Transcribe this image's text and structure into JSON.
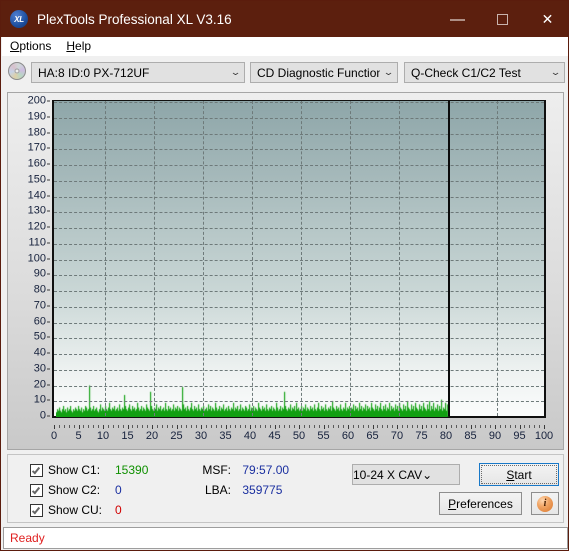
{
  "window": {
    "title": "PlexTools Professional XL V3.16",
    "icon": "xl-logo-icon",
    "minimize": "–",
    "maximize": "maximize-icon",
    "close": "✕"
  },
  "menubar": {
    "items": [
      {
        "label": "Options",
        "accel": "O"
      },
      {
        "label": "Help",
        "accel": "H"
      }
    ]
  },
  "toolbar": {
    "drive_icon": "cd-disc-icon",
    "drive": "HA:8 ID:0  PX-712UF",
    "function": "CD Diagnostic Functions",
    "test": "Q-Check C1/C2 Test",
    "chevron": "⌄"
  },
  "legend": {
    "rows": [
      {
        "label": "Show C1:",
        "value": "15390",
        "color": "#0f9000",
        "checked": true
      },
      {
        "label": "Show C2:",
        "value": "0",
        "color": "#1a2fa0",
        "checked": true
      },
      {
        "label": "Show CU:",
        "value": "0",
        "color": "#d00000",
        "checked": true
      }
    ]
  },
  "readouts": [
    {
      "key": "MSF:",
      "value": "79:57.00"
    },
    {
      "key": "LBA:",
      "value": "359775"
    }
  ],
  "controls": {
    "speed": "10-24 X CAV",
    "speed_chevron": "⌄",
    "start": "Start",
    "start_accel": "S",
    "preferences": "Preferences",
    "preferences_accel": "P",
    "info_icon": "info-circle-icon",
    "info_glyph": "i"
  },
  "statusbar": {
    "text": "Ready"
  },
  "chart_data": {
    "type": "bar",
    "title": "",
    "xlabel": "",
    "ylabel": "",
    "xlim": [
      0,
      100
    ],
    "ylim": [
      0,
      200
    ],
    "xticks": [
      0,
      5,
      10,
      15,
      20,
      25,
      30,
      35,
      40,
      45,
      50,
      55,
      60,
      65,
      70,
      75,
      80,
      85,
      90,
      95,
      100
    ],
    "yticks": [
      0,
      10,
      20,
      30,
      40,
      50,
      60,
      70,
      80,
      90,
      100,
      110,
      120,
      130,
      140,
      150,
      160,
      170,
      180,
      190,
      200
    ],
    "grid": true,
    "legend_position": "below-plot",
    "data_end_x": 80,
    "end_marker_x": 80,
    "series": [
      {
        "name": "C1",
        "color": "#12a012",
        "x_start": 0,
        "x_end": 80,
        "n_points": 396,
        "baseline": 4,
        "typical_max": 12,
        "spike_max": 21,
        "values": [
          3,
          5,
          4,
          6,
          4,
          3,
          5,
          7,
          4,
          5,
          3,
          6,
          4,
          5,
          7,
          4,
          3,
          5,
          4,
          6,
          5,
          4,
          7,
          5,
          4,
          6,
          3,
          5,
          4,
          7,
          6,
          4,
          5,
          20,
          6,
          4,
          5,
          7,
          4,
          5,
          6,
          4,
          3,
          5,
          8,
          4,
          6,
          5,
          4,
          7,
          5,
          4,
          6,
          9,
          5,
          4,
          6,
          5,
          7,
          4,
          5,
          6,
          4,
          8,
          5,
          4,
          6,
          5,
          14,
          7,
          5,
          4,
          6,
          8,
          5,
          4,
          7,
          5,
          6,
          4,
          5,
          9,
          6,
          4,
          5,
          7,
          4,
          6,
          5,
          4,
          8,
          6,
          5,
          4,
          16,
          7,
          5,
          4,
          6,
          5,
          8,
          4,
          6,
          5,
          7,
          4,
          5,
          6,
          4,
          9,
          5,
          4,
          7,
          5,
          6,
          4,
          5,
          8,
          4,
          6,
          5,
          7,
          4,
          6,
          5,
          4,
          19,
          8,
          5,
          6,
          4,
          7,
          5,
          4,
          6,
          9,
          5,
          4,
          7,
          5,
          6,
          4,
          8,
          5,
          4,
          6,
          5,
          7,
          4,
          5,
          6,
          4,
          8,
          5,
          7,
          4,
          6,
          5,
          4,
          9,
          6,
          4,
          5,
          7,
          4,
          6,
          5,
          8,
          4,
          5,
          6,
          4,
          7,
          5,
          4,
          6,
          5,
          9,
          4,
          6,
          5,
          7,
          4,
          5,
          8,
          4,
          6,
          5,
          4,
          7,
          6,
          4,
          5,
          8,
          4,
          6,
          5,
          7,
          4,
          6,
          5,
          4,
          9,
          6,
          5,
          4,
          7,
          5,
          6,
          4,
          8,
          5,
          4,
          6,
          5,
          7,
          4,
          6,
          5,
          4,
          9,
          6,
          4,
          5,
          7,
          4,
          6,
          5,
          16,
          7,
          5,
          4,
          6,
          5,
          8,
          4,
          6,
          5,
          7,
          4,
          9,
          5,
          6,
          4,
          5,
          7,
          4,
          6,
          5,
          8,
          4,
          6,
          5,
          4,
          7,
          5,
          6,
          4,
          8,
          5,
          4,
          6,
          9,
          5,
          4,
          7,
          5,
          6,
          4,
          8,
          5,
          4,
          6,
          5,
          7,
          4,
          10,
          6,
          5,
          4,
          7,
          5,
          6,
          4,
          8,
          5,
          4,
          6,
          5,
          9,
          4,
          6,
          5,
          7,
          4,
          6,
          5,
          8,
          4,
          7,
          5,
          6,
          4,
          9,
          5,
          7,
          4,
          6,
          5,
          8,
          4,
          7,
          5,
          6,
          4,
          9,
          6,
          5,
          4,
          8,
          5,
          7,
          4,
          6,
          9,
          5,
          4,
          7,
          5,
          8,
          4,
          6,
          5,
          9,
          4,
          7,
          5,
          6,
          4,
          8,
          5,
          7,
          4,
          9,
          6,
          5,
          4,
          8,
          5,
          7,
          4,
          10,
          6,
          5,
          4,
          8,
          5,
          7,
          4,
          9,
          6,
          5,
          4,
          8,
          5,
          7,
          4,
          9,
          6,
          5,
          4,
          8,
          5,
          10,
          4,
          7,
          5,
          9,
          4,
          6,
          5,
          8,
          4,
          7,
          5,
          11,
          4,
          6,
          5,
          9,
          4,
          8
        ]
      }
    ]
  }
}
